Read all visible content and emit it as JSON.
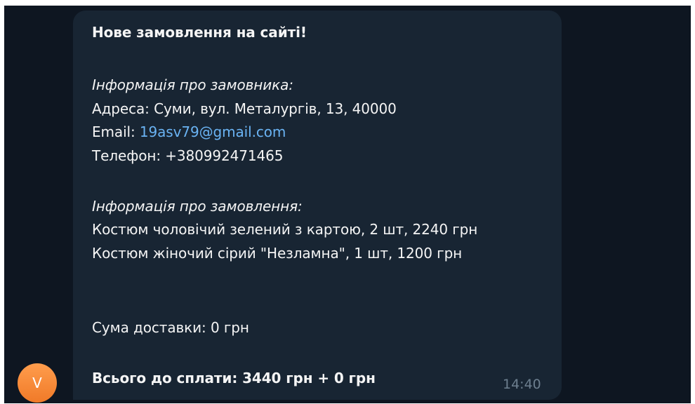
{
  "message": {
    "title": "Нове замовлення на сайті!",
    "customer_heading": "Інформація про замовника:",
    "address_label": "Адреса:",
    "address_value": "Суми, вул. Металургів, 13, 40000",
    "email_label": "Email:",
    "email_value": "19asv79@gmail.com",
    "phone_label": "Телефон:",
    "phone_value": "+380992471465",
    "order_heading": "Інформація про замовлення:",
    "items": [
      "Костюм чоловічий зелений з картою, 2 шт, 2240 грн",
      "Костюм жіночий сірий \"Незламна\", 1 шт, 1200 грн"
    ],
    "delivery_label": "Сума доставки:",
    "delivery_value": "0 грн",
    "total": "Всього до сплати: 3440 грн + 0 грн",
    "time": "14:40"
  },
  "sender": {
    "avatar_letter": "V",
    "avatar_color": "#f58a36"
  },
  "colors": {
    "chat_background": "#0e1621",
    "bubble": "#182533",
    "text": "#f5f5f5",
    "link": "#6ab3f3",
    "timestamp": "#6d7f8f"
  }
}
